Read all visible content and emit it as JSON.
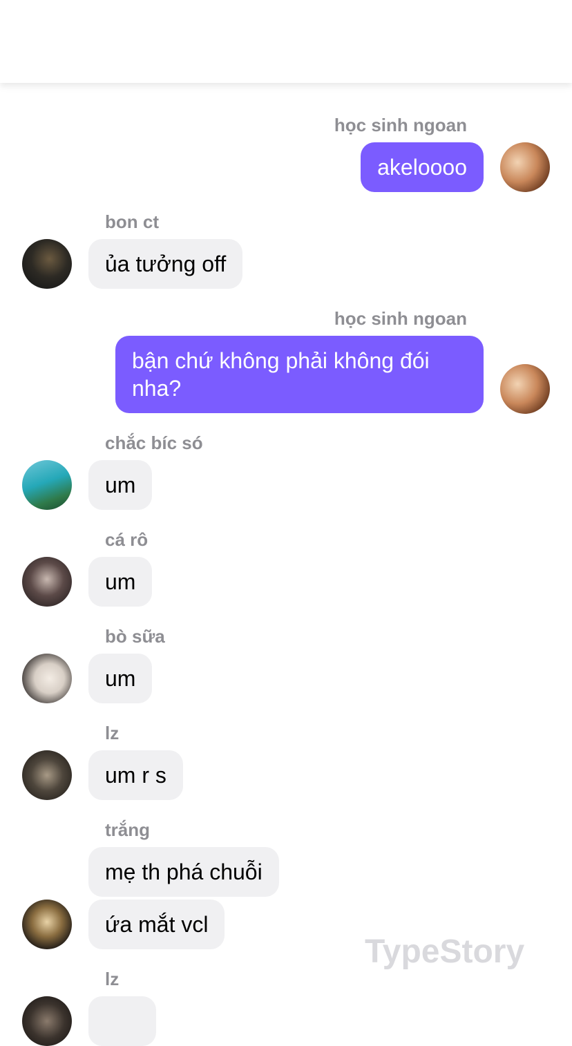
{
  "messages": [
    {
      "sender": "học sinh ngoan",
      "text": "akeloooo",
      "side": "right"
    },
    {
      "sender": "bon ct",
      "text": "ủa tưởng off",
      "side": "left"
    },
    {
      "sender": "học sinh ngoan",
      "text": "bận chứ không phải không đói nha?",
      "side": "right"
    },
    {
      "sender": "chắc bíc só",
      "text": "um",
      "side": "left"
    },
    {
      "sender": "cá rô",
      "text": "um",
      "side": "left"
    },
    {
      "sender": "bò sữa",
      "text": "um",
      "side": "left"
    },
    {
      "sender": "lz",
      "text": "um r s",
      "side": "left"
    },
    {
      "sender": "trắng",
      "text": "mẹ th phá chuỗi",
      "side": "left"
    },
    {
      "sender": "trắng",
      "text": "ứa mắt vcl",
      "side": "left"
    },
    {
      "sender": "lz",
      "text": "",
      "side": "left"
    }
  ],
  "watermark": "TypeStory",
  "colors": {
    "outgoing_bubble": "#7b5cff",
    "incoming_bubble": "#f0f0f2",
    "sender_name": "#8e8e93",
    "watermark": "#d9d9dd"
  }
}
